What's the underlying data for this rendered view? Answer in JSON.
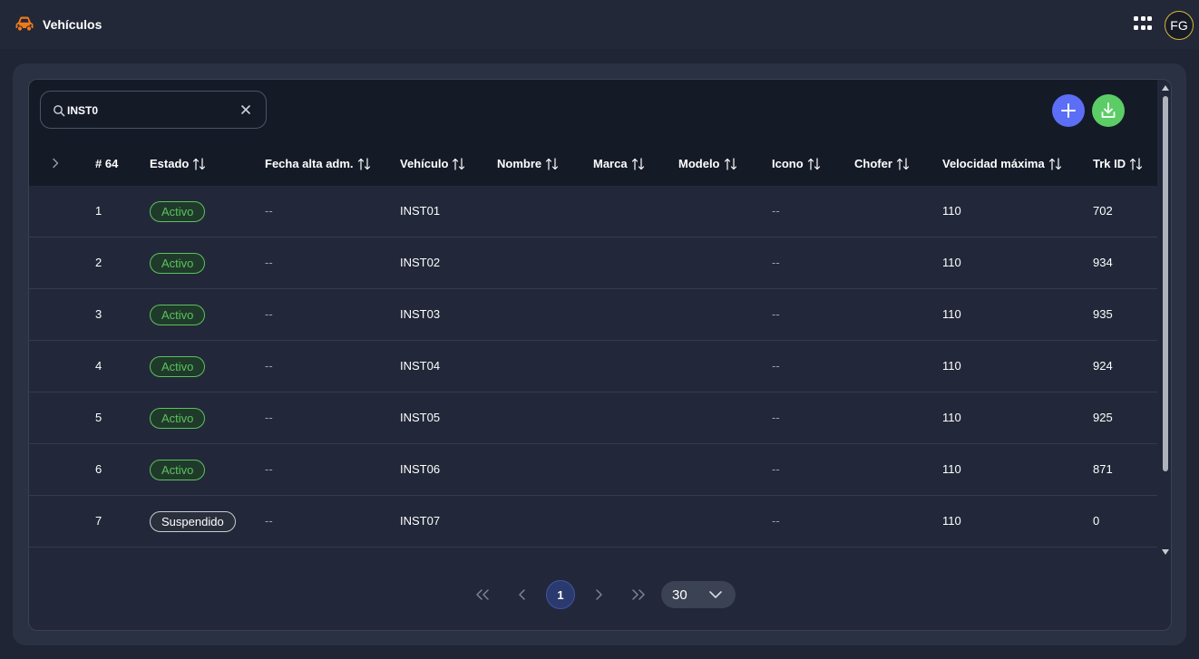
{
  "app": {
    "title": "Vehículos",
    "avatar_initials": "FG"
  },
  "search": {
    "value": "INST0",
    "placeholder": ""
  },
  "table": {
    "count_header": "# 64",
    "columns": [
      "Estado",
      "Fecha alta adm.",
      "Vehículo",
      "Nombre",
      "Marca",
      "Modelo",
      "Icono",
      "Chofer",
      "Velocidad máxima",
      "Trk ID"
    ],
    "rows": [
      {
        "n": "1",
        "estado": "Activo",
        "fecha": "--",
        "vehiculo": "INST01",
        "nombre": "",
        "marca": "",
        "modelo": "",
        "icono": "--",
        "chofer": "",
        "velocidad": "110",
        "trk": "702"
      },
      {
        "n": "2",
        "estado": "Activo",
        "fecha": "--",
        "vehiculo": "INST02",
        "nombre": "",
        "marca": "",
        "modelo": "",
        "icono": "--",
        "chofer": "",
        "velocidad": "110",
        "trk": "934"
      },
      {
        "n": "3",
        "estado": "Activo",
        "fecha": "--",
        "vehiculo": "INST03",
        "nombre": "",
        "marca": "",
        "modelo": "",
        "icono": "--",
        "chofer": "",
        "velocidad": "110",
        "trk": "935"
      },
      {
        "n": "4",
        "estado": "Activo",
        "fecha": "--",
        "vehiculo": "INST04",
        "nombre": "",
        "marca": "",
        "modelo": "",
        "icono": "--",
        "chofer": "",
        "velocidad": "110",
        "trk": "924"
      },
      {
        "n": "5",
        "estado": "Activo",
        "fecha": "--",
        "vehiculo": "INST05",
        "nombre": "",
        "marca": "",
        "modelo": "",
        "icono": "--",
        "chofer": "",
        "velocidad": "110",
        "trk": "925"
      },
      {
        "n": "6",
        "estado": "Activo",
        "fecha": "--",
        "vehiculo": "INST06",
        "nombre": "",
        "marca": "",
        "modelo": "",
        "icono": "--",
        "chofer": "",
        "velocidad": "110",
        "trk": "871"
      },
      {
        "n": "7",
        "estado": "Suspendido",
        "fecha": "--",
        "vehiculo": "INST07",
        "nombre": "",
        "marca": "",
        "modelo": "",
        "icono": "--",
        "chofer": "",
        "velocidad": "110",
        "trk": "0"
      }
    ]
  },
  "pagination": {
    "current_page": "1",
    "page_size": "30"
  },
  "icons": {
    "brand": "car-icon",
    "apps": "apps-grid-icon",
    "search": "search-icon",
    "clear": "close-icon",
    "add": "plus-icon",
    "download": "download-icon",
    "sort": "sort-icon",
    "expand": "chevron-right-icon"
  },
  "colors": {
    "accent_add": "#5b6ef5",
    "accent_download": "#5ccd66",
    "status_active": "#5cc15f",
    "brand_icon": "#f07a1a",
    "avatar_ring": "#d9b832"
  }
}
